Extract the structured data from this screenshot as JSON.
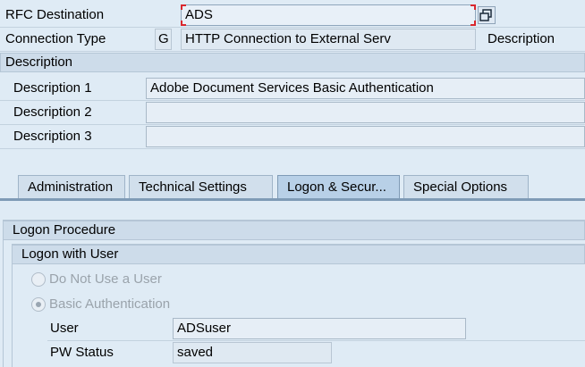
{
  "header": {
    "rfc_destination_label": "RFC Destination",
    "rfc_destination_value": "ADS",
    "connection_type_label": "Connection Type",
    "connection_type_code": "G",
    "connection_type_text": "HTTP Connection to External Serv",
    "description_label": "Description"
  },
  "description_section": {
    "title": "Description",
    "rows": [
      {
        "label": "Description 1",
        "value": "Adobe Document Services Basic Authentication"
      },
      {
        "label": "Description 2",
        "value": ""
      },
      {
        "label": "Description 3",
        "value": ""
      }
    ]
  },
  "tabs": [
    {
      "label": "Administration",
      "active": false
    },
    {
      "label": "Technical Settings",
      "active": false
    },
    {
      "label": "Logon & Secur...",
      "active": true
    },
    {
      "label": "Special Options",
      "active": false
    }
  ],
  "logon_procedure": {
    "title": "Logon Procedure",
    "logon_with_user": {
      "title": "Logon with User",
      "options": [
        {
          "label": "Do Not Use a User",
          "selected": false
        },
        {
          "label": "Basic Authentication",
          "selected": true
        }
      ],
      "user_label": "User",
      "user_value": "ADSuser",
      "pw_status_label": "PW Status",
      "pw_status_value": "saved"
    }
  },
  "colors": {
    "background": "#dfebf5",
    "header_bar": "#cddcea",
    "active_tab": "#b8d0e7",
    "focus_marker": "#d9272e"
  },
  "icons": {
    "rfc_destination_button": "copy-windows-icon"
  }
}
